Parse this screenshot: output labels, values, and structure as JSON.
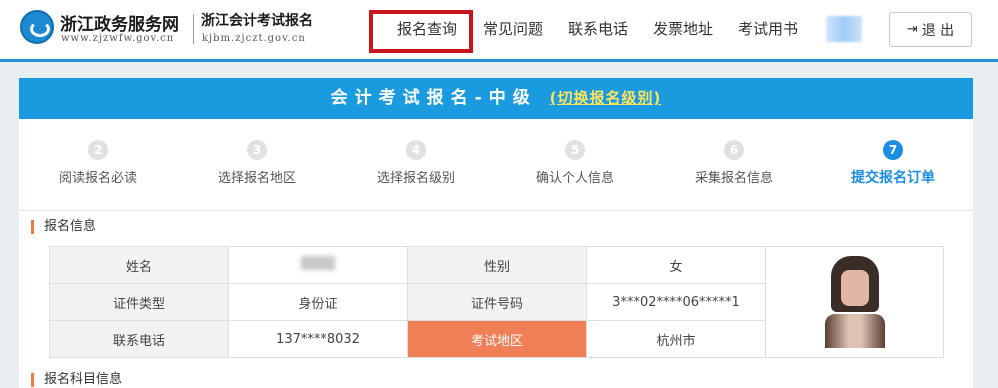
{
  "header": {
    "brand_title": "浙江政务服务网",
    "brand_url": "www.zjzwfw.gov.cn",
    "sub_title": "浙江会计考试报名",
    "sub_url": "kjbm.zjczt.gov.cn",
    "nav": [
      "报名查询",
      "常见问题",
      "联系电话",
      "发票地址",
      "考试用书"
    ],
    "logout_label": "退 出",
    "accent_color": "#1e8fd6",
    "highlight_color": "#c8141c"
  },
  "banner": {
    "title": "会计考试报名-中级",
    "link": "(切换报名级别)",
    "color": "#1a9be0"
  },
  "steps": [
    {
      "num": "2",
      "label": "阅读报名必读"
    },
    {
      "num": "3",
      "label": "选择报名地区"
    },
    {
      "num": "4",
      "label": "选择报名级别"
    },
    {
      "num": "5",
      "label": "确认个人信息"
    },
    {
      "num": "6",
      "label": "采集报名信息"
    },
    {
      "num": "7",
      "label": "提交报名订单"
    }
  ],
  "active_step": "7",
  "sections": {
    "info_title": "报名信息",
    "subject_title": "报名科目信息"
  },
  "info": {
    "name_label": "姓名",
    "gender_label": "性别",
    "gender_value": "女",
    "id_type_label": "证件类型",
    "id_type_value": "身份证",
    "id_no_label": "证件号码",
    "id_no_value": "3***02****06*****1",
    "phone_label": "联系电话",
    "phone_value": "137****8032",
    "region_label": "考试地区",
    "region_value": "杭州市",
    "region_label_color": "#f07f57"
  }
}
